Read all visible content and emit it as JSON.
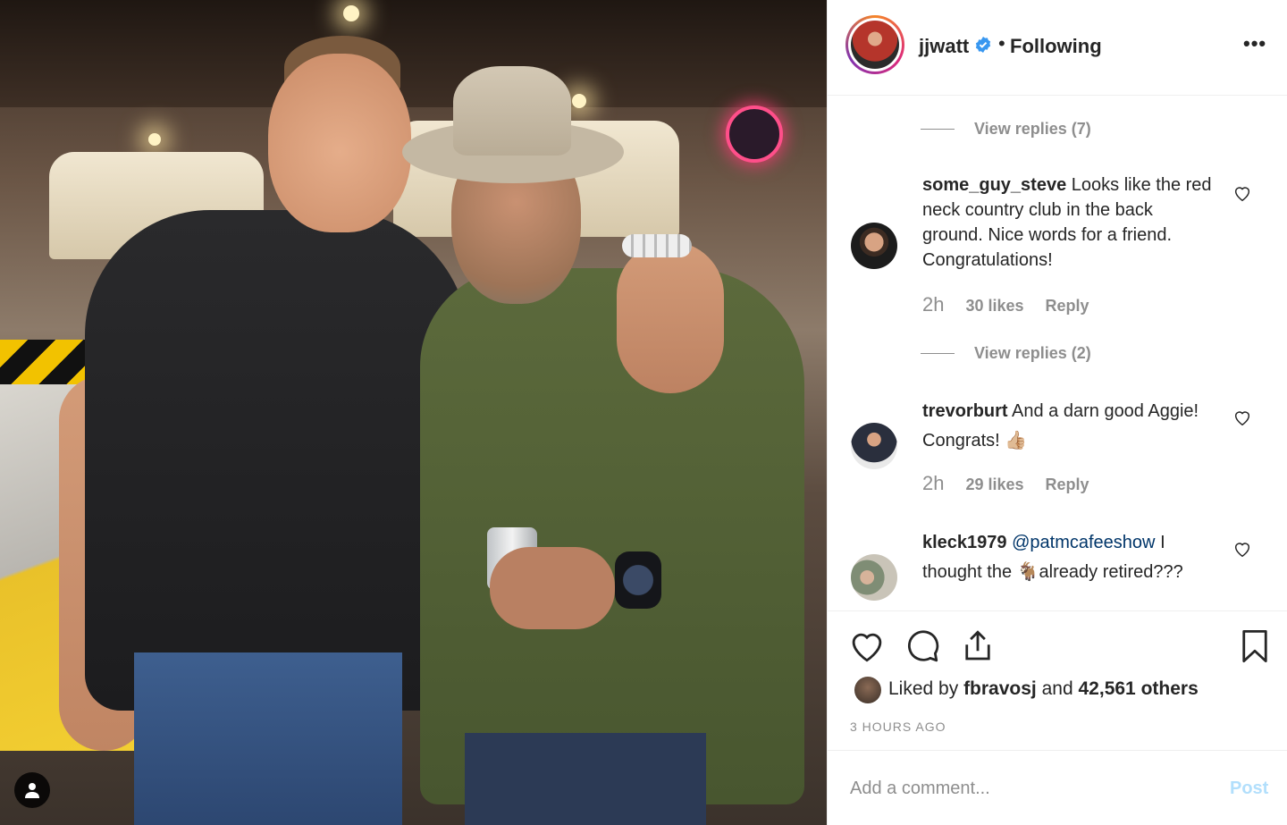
{
  "post": {
    "author": "jjwatt",
    "verified": true,
    "separator": "•",
    "follow_state": "Following",
    "more_label": "•••"
  },
  "comments": [
    {
      "type": "view_replies",
      "label": "View replies (7)"
    },
    {
      "type": "comment",
      "user": "some_guy_steve",
      "text": "Looks like the red neck country club in the back ground. Nice words for a friend. Congratulations!",
      "time": "2h",
      "likes": "30 likes",
      "reply": "Reply"
    },
    {
      "type": "view_replies",
      "label": "View replies (2)"
    },
    {
      "type": "comment",
      "user": "trevorburt",
      "text": "And a darn good Aggie! Congrats! 👍🏼",
      "time": "2h",
      "likes": "29 likes",
      "reply": "Reply"
    },
    {
      "type": "comment",
      "user": "kleck1979",
      "mention": "@patmcafeeshow",
      "text": "I thought the 🐐already retired???"
    }
  ],
  "likes": {
    "prefix": "Liked by",
    "user": "fbravosj",
    "middle": "and",
    "others": "42,561 others"
  },
  "timestamp": "3 HOURS AGO",
  "add_comment": {
    "placeholder": "Add a comment...",
    "post_label": "Post"
  },
  "colors": {
    "link": "#003569",
    "muted": "#8e8e8e",
    "post_disabled": "#b2dffc",
    "verified": "#3897f0"
  },
  "icons": [
    "user-tag-icon",
    "verified-icon",
    "more-icon",
    "heart-icon",
    "comment-icon",
    "share-icon",
    "bookmark-icon"
  ]
}
